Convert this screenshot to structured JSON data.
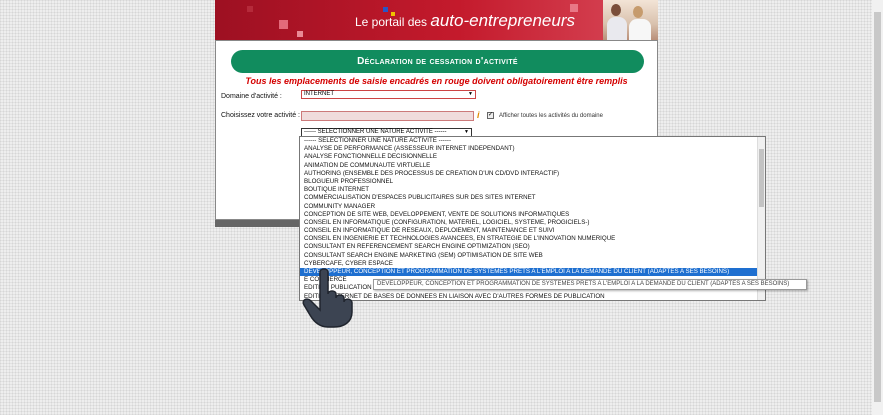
{
  "banner": {
    "prefix": "Le portail des",
    "brand": "auto-entrepreneurs"
  },
  "form": {
    "title": "Déclaration de cessation d'activité",
    "warning": "Tous les emplacements de saisie encadrés en rouge doivent obligatoirement être remplis",
    "domain_label": "Domaine d'activité :",
    "domain_value": "INTERNET",
    "activity_label": "Choisissez votre activité :",
    "activity_value": "",
    "info_icon": "i",
    "show_all_label": "Afficher toutes les activités du domaine",
    "show_all_checked": true,
    "nature_value": "------ SELECTIONNER UNE NATURE ACTIVITE ------"
  },
  "dropdown": {
    "items": [
      "------ SELECTIONNER UNE NATURE ACTIVITE ------",
      "ANALYSE DE PERFORMANCE (ASSESSEUR INTERNET INDEPENDANT)",
      "ANALYSE FONCTIONNELLE DECISIONNELLE",
      "ANIMATION DE COMMUNAUTE VIRTUELLE",
      "AUTHORING (ENSEMBLE DES PROCESSUS DE CREATION D'UN CD/DVD INTERACTIF)",
      "BLOGUEUR PROFESSIONNEL",
      "BOUTIQUE INTERNET",
      "COMMERCIALISATION D'ESPACES PUBLICITAIRES SUR DES SITES INTERNET",
      "COMMUNITY MANAGER",
      "CONCEPTION DE SITE WEB, DEVELOPPEMENT, VENTE DE SOLUTIONS INFORMATIQUES",
      "CONSEIL EN INFORMATIQUE (CONFIGURATION, MATERIEL, LOGICIEL, SYSTEME, PROGICIELS-)",
      "CONSEIL EN INFORMATIQUE DE RESEAUX, DEPLOIEMENT, MAINTENANCE ET SUIVI",
      "CONSEIL EN INGENIERIE ET TECHNOLOGIES AVANCEES, EN STRATEGIE DE L'INNOVATION NUMERIQUE",
      "CONSULTANT EN REFERENCEMENT SEARCH ENGINE OPTIMIZATION (SEO)",
      "CONSULTANT SEARCH ENGINE MARKETING (SEM) OPTIMISATION DE SITE WEB",
      "CYBERCAFE, CYBER ESPACE",
      "DEVELOPPEUR, CONCEPTION ET PROGRAMMATION DE SYSTEMES PRETS A L'EMPLOI A LA DEMANDE DU CLIENT (ADAPTES A SES BESOINS)",
      "E COMMERCE",
      "EDITION PUBLICATION",
      "EDITION INTERNET DE BASES DE DONNEES EN LIAISON AVEC D'AUTRES FORMES DE PUBLICATION"
    ],
    "highlighted_index": 16,
    "tooltip": "DEVELOPPEUR, CONCEPTION ET PROGRAMMATION DE SYSTEMES PRETS A L'EMPLOI A LA DEMANDE DU CLIENT (ADAPTES A SES BESOINS)"
  },
  "colors": {
    "banner_red": "#c41a2c",
    "title_green": "#118c5e",
    "warning_red": "#d40000",
    "highlight_blue": "#1e6fd0"
  }
}
